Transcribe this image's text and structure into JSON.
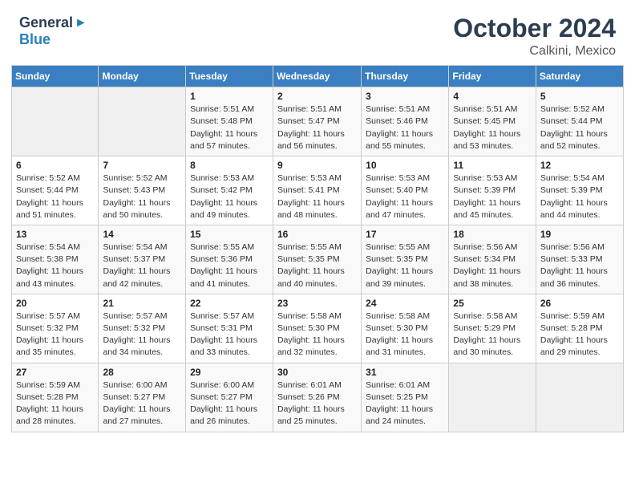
{
  "header": {
    "logo_general": "General",
    "logo_blue": "Blue",
    "main_title": "October 2024",
    "subtitle": "Calkini, Mexico"
  },
  "calendar": {
    "days_of_week": [
      "Sunday",
      "Monday",
      "Tuesday",
      "Wednesday",
      "Thursday",
      "Friday",
      "Saturday"
    ],
    "weeks": [
      [
        {
          "day": "",
          "sunrise": "",
          "sunset": "",
          "daylight": ""
        },
        {
          "day": "",
          "sunrise": "",
          "sunset": "",
          "daylight": ""
        },
        {
          "day": "1",
          "sunrise": "Sunrise: 5:51 AM",
          "sunset": "Sunset: 5:48 PM",
          "daylight": "Daylight: 11 hours and 57 minutes."
        },
        {
          "day": "2",
          "sunrise": "Sunrise: 5:51 AM",
          "sunset": "Sunset: 5:47 PM",
          "daylight": "Daylight: 11 hours and 56 minutes."
        },
        {
          "day": "3",
          "sunrise": "Sunrise: 5:51 AM",
          "sunset": "Sunset: 5:46 PM",
          "daylight": "Daylight: 11 hours and 55 minutes."
        },
        {
          "day": "4",
          "sunrise": "Sunrise: 5:51 AM",
          "sunset": "Sunset: 5:45 PM",
          "daylight": "Daylight: 11 hours and 53 minutes."
        },
        {
          "day": "5",
          "sunrise": "Sunrise: 5:52 AM",
          "sunset": "Sunset: 5:44 PM",
          "daylight": "Daylight: 11 hours and 52 minutes."
        }
      ],
      [
        {
          "day": "6",
          "sunrise": "Sunrise: 5:52 AM",
          "sunset": "Sunset: 5:44 PM",
          "daylight": "Daylight: 11 hours and 51 minutes."
        },
        {
          "day": "7",
          "sunrise": "Sunrise: 5:52 AM",
          "sunset": "Sunset: 5:43 PM",
          "daylight": "Daylight: 11 hours and 50 minutes."
        },
        {
          "day": "8",
          "sunrise": "Sunrise: 5:53 AM",
          "sunset": "Sunset: 5:42 PM",
          "daylight": "Daylight: 11 hours and 49 minutes."
        },
        {
          "day": "9",
          "sunrise": "Sunrise: 5:53 AM",
          "sunset": "Sunset: 5:41 PM",
          "daylight": "Daylight: 11 hours and 48 minutes."
        },
        {
          "day": "10",
          "sunrise": "Sunrise: 5:53 AM",
          "sunset": "Sunset: 5:40 PM",
          "daylight": "Daylight: 11 hours and 47 minutes."
        },
        {
          "day": "11",
          "sunrise": "Sunrise: 5:53 AM",
          "sunset": "Sunset: 5:39 PM",
          "daylight": "Daylight: 11 hours and 45 minutes."
        },
        {
          "day": "12",
          "sunrise": "Sunrise: 5:54 AM",
          "sunset": "Sunset: 5:39 PM",
          "daylight": "Daylight: 11 hours and 44 minutes."
        }
      ],
      [
        {
          "day": "13",
          "sunrise": "Sunrise: 5:54 AM",
          "sunset": "Sunset: 5:38 PM",
          "daylight": "Daylight: 11 hours and 43 minutes."
        },
        {
          "day": "14",
          "sunrise": "Sunrise: 5:54 AM",
          "sunset": "Sunset: 5:37 PM",
          "daylight": "Daylight: 11 hours and 42 minutes."
        },
        {
          "day": "15",
          "sunrise": "Sunrise: 5:55 AM",
          "sunset": "Sunset: 5:36 PM",
          "daylight": "Daylight: 11 hours and 41 minutes."
        },
        {
          "day": "16",
          "sunrise": "Sunrise: 5:55 AM",
          "sunset": "Sunset: 5:35 PM",
          "daylight": "Daylight: 11 hours and 40 minutes."
        },
        {
          "day": "17",
          "sunrise": "Sunrise: 5:55 AM",
          "sunset": "Sunset: 5:35 PM",
          "daylight": "Daylight: 11 hours and 39 minutes."
        },
        {
          "day": "18",
          "sunrise": "Sunrise: 5:56 AM",
          "sunset": "Sunset: 5:34 PM",
          "daylight": "Daylight: 11 hours and 38 minutes."
        },
        {
          "day": "19",
          "sunrise": "Sunrise: 5:56 AM",
          "sunset": "Sunset: 5:33 PM",
          "daylight": "Daylight: 11 hours and 36 minutes."
        }
      ],
      [
        {
          "day": "20",
          "sunrise": "Sunrise: 5:57 AM",
          "sunset": "Sunset: 5:32 PM",
          "daylight": "Daylight: 11 hours and 35 minutes."
        },
        {
          "day": "21",
          "sunrise": "Sunrise: 5:57 AM",
          "sunset": "Sunset: 5:32 PM",
          "daylight": "Daylight: 11 hours and 34 minutes."
        },
        {
          "day": "22",
          "sunrise": "Sunrise: 5:57 AM",
          "sunset": "Sunset: 5:31 PM",
          "daylight": "Daylight: 11 hours and 33 minutes."
        },
        {
          "day": "23",
          "sunrise": "Sunrise: 5:58 AM",
          "sunset": "Sunset: 5:30 PM",
          "daylight": "Daylight: 11 hours and 32 minutes."
        },
        {
          "day": "24",
          "sunrise": "Sunrise: 5:58 AM",
          "sunset": "Sunset: 5:30 PM",
          "daylight": "Daylight: 11 hours and 31 minutes."
        },
        {
          "day": "25",
          "sunrise": "Sunrise: 5:58 AM",
          "sunset": "Sunset: 5:29 PM",
          "daylight": "Daylight: 11 hours and 30 minutes."
        },
        {
          "day": "26",
          "sunrise": "Sunrise: 5:59 AM",
          "sunset": "Sunset: 5:28 PM",
          "daylight": "Daylight: 11 hours and 29 minutes."
        }
      ],
      [
        {
          "day": "27",
          "sunrise": "Sunrise: 5:59 AM",
          "sunset": "Sunset: 5:28 PM",
          "daylight": "Daylight: 11 hours and 28 minutes."
        },
        {
          "day": "28",
          "sunrise": "Sunrise: 6:00 AM",
          "sunset": "Sunset: 5:27 PM",
          "daylight": "Daylight: 11 hours and 27 minutes."
        },
        {
          "day": "29",
          "sunrise": "Sunrise: 6:00 AM",
          "sunset": "Sunset: 5:27 PM",
          "daylight": "Daylight: 11 hours and 26 minutes."
        },
        {
          "day": "30",
          "sunrise": "Sunrise: 6:01 AM",
          "sunset": "Sunset: 5:26 PM",
          "daylight": "Daylight: 11 hours and 25 minutes."
        },
        {
          "day": "31",
          "sunrise": "Sunrise: 6:01 AM",
          "sunset": "Sunset: 5:25 PM",
          "daylight": "Daylight: 11 hours and 24 minutes."
        },
        {
          "day": "",
          "sunrise": "",
          "sunset": "",
          "daylight": ""
        },
        {
          "day": "",
          "sunrise": "",
          "sunset": "",
          "daylight": ""
        }
      ]
    ]
  }
}
